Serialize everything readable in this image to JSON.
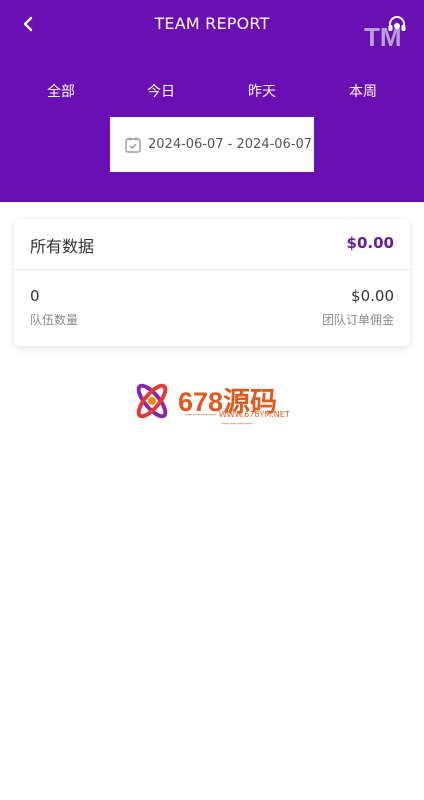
{
  "header": {
    "title": "TEAM REPORT",
    "watermark": "TM",
    "background": "#6a0fb3"
  },
  "tabs": [
    {
      "label": "全部"
    },
    {
      "label": "今日"
    },
    {
      "label": "昨天"
    },
    {
      "label": "本周"
    }
  ],
  "date_range": {
    "text": "2024-06-07 -  2024-06-07"
  },
  "summary": {
    "title": "所有数据",
    "total": "$0.00",
    "team_count_value": "0",
    "team_count_label": "队伍数量",
    "commission_value": "$0.00",
    "commission_label": "团队订单佣金"
  },
  "logo": {
    "name": "678源码",
    "url": "WWW.678YM.NET"
  },
  "colors": {
    "accent": "#6a0fb3",
    "total": "#6a1b9a",
    "logo": "#e05a1e"
  }
}
